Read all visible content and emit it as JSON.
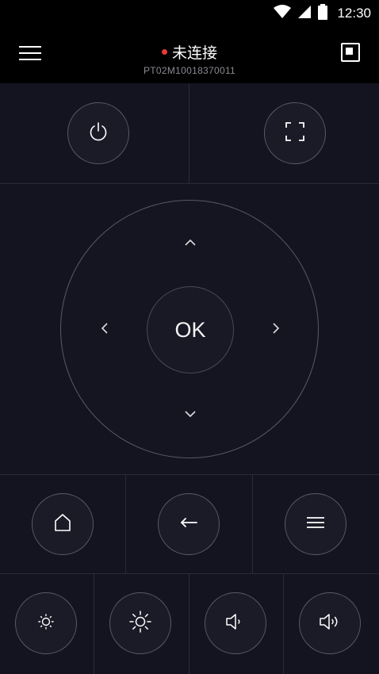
{
  "status_bar": {
    "time": "12:30",
    "icons": [
      "wifi-icon",
      "signal-icon",
      "battery-icon"
    ]
  },
  "header": {
    "title": "未连接",
    "device_id": "PT02M10018370011",
    "status_color": "#e83a3a"
  },
  "dpad": {
    "ok_label": "OK"
  },
  "controls": {
    "row1": [
      "power-icon",
      "fullscreen-icon"
    ],
    "row3": [
      "home-icon",
      "back-arrow-icon",
      "menu-icon"
    ],
    "row4": [
      "brightness-down-icon",
      "brightness-up-icon",
      "volume-down-icon",
      "volume-up-icon"
    ]
  },
  "colors": {
    "background": "#141421",
    "topbar": "#000000",
    "ring": "#5a5a66"
  }
}
